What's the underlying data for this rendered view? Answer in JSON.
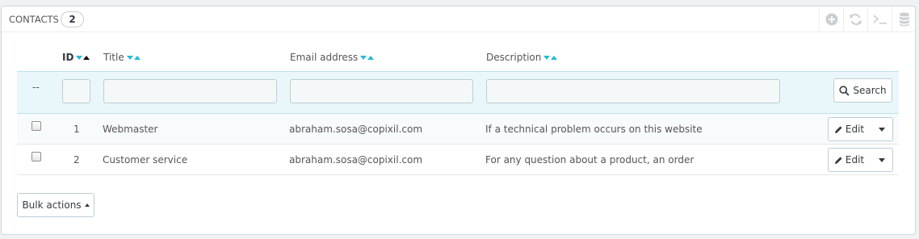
{
  "panel": {
    "title": "CONTACTS",
    "count": "2",
    "toolbar": [
      {
        "name": "add-new-icon",
        "label": "Add new"
      },
      {
        "name": "refresh-icon",
        "label": "Refresh list"
      },
      {
        "name": "terminal-icon",
        "label": "Show SQL query"
      },
      {
        "name": "database-icon",
        "label": "Export to SQL Manager"
      }
    ]
  },
  "table": {
    "columns": [
      {
        "label": "ID"
      },
      {
        "label": "Title"
      },
      {
        "label": "Email address"
      },
      {
        "label": "Description"
      }
    ],
    "filter": {
      "dash": "--",
      "search_label": "Search"
    },
    "rows": [
      {
        "id": "1",
        "title": "Webmaster",
        "email": "abraham.sosa@copixil.com",
        "description": "If a technical problem occurs on this website",
        "edit_label": "Edit"
      },
      {
        "id": "2",
        "title": "Customer service",
        "email": "abraham.sosa@copixil.com",
        "description": "For any question about a product, an order",
        "edit_label": "Edit"
      }
    ]
  },
  "bulk_actions": {
    "label": "Bulk actions"
  },
  "colors": {
    "accent": "#25b9d7",
    "filter_bg": "#eaf7fa",
    "border": "#bbcdd2"
  }
}
